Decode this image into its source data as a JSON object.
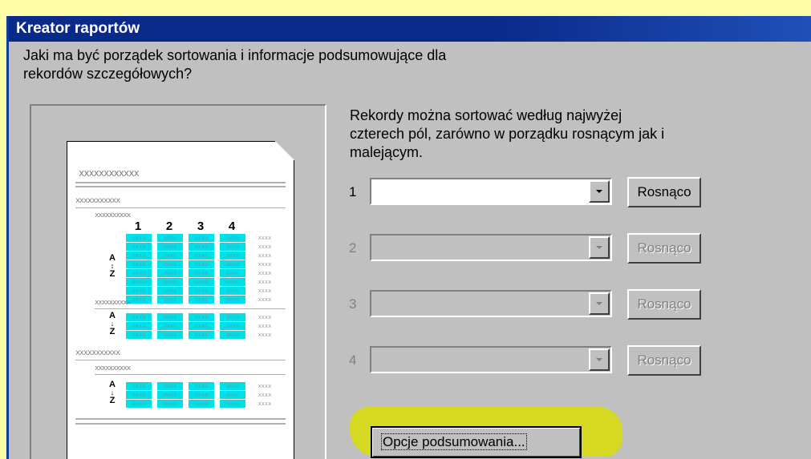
{
  "window": {
    "title": "Kreator raportów"
  },
  "question": {
    "line1": "Jaki ma być porządek sortowania i informacje podsumowujące dla",
    "line2": "rekordów szczegółowych?"
  },
  "description": {
    "line1": "Rekordy można sortować według najwyżej",
    "line2": "czterech pól, zarówno w porządku rosnącym jak i",
    "line3": "malejącym."
  },
  "sort_fields": [
    {
      "number": "1",
      "button_label": "Rosnąco",
      "enabled": true
    },
    {
      "number": "2",
      "button_label": "Rosnąco",
      "enabled": false
    },
    {
      "number": "3",
      "button_label": "Rosnąco",
      "enabled": false
    },
    {
      "number": "4",
      "button_label": "Rosnąco",
      "enabled": false
    }
  ],
  "summary_button": {
    "label": "Opcje podsumowania..."
  },
  "preview": {
    "header_placeholder": "xxxxxxxxxxxx",
    "group_placeholder": "xxxxxxxxxxx",
    "sub_placeholder": "xxxxxxxxxx",
    "column_numbers": [
      "1",
      "2",
      "3",
      "4"
    ],
    "cell_text": "xxxx",
    "sort_top": "A",
    "sort_bottom": "Z"
  },
  "colors": {
    "title_bar": "#0a2a8a",
    "dialog_bg": "#c0c0c0",
    "highlight": "#d8dc10",
    "preview_cells": "#00e0e8"
  }
}
